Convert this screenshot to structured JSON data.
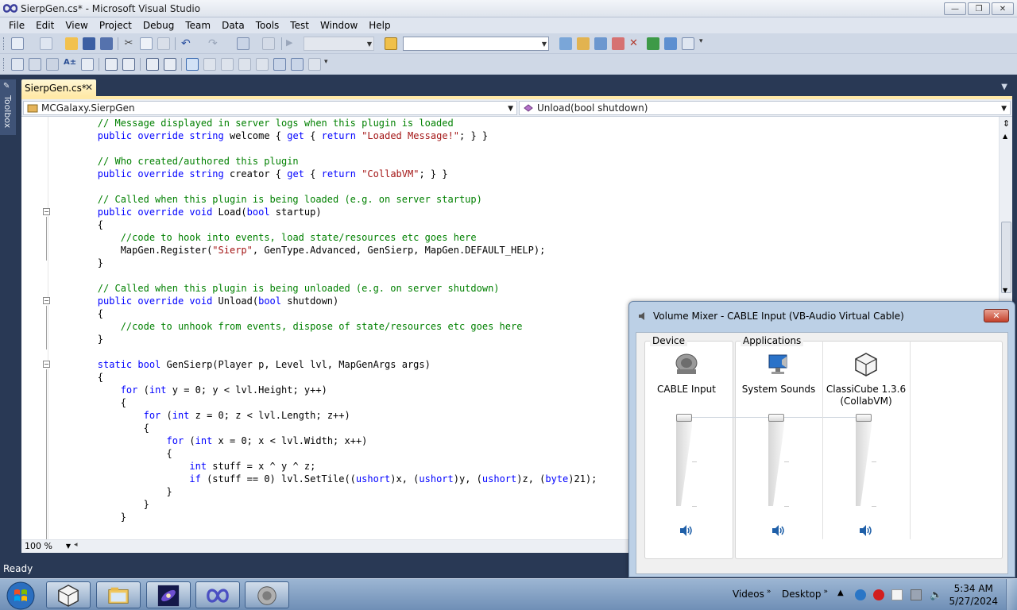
{
  "window": {
    "title": "SierpGen.cs* - Microsoft Visual Studio",
    "min_glyph": "—",
    "max_glyph": "❐",
    "close_glyph": "✕"
  },
  "menu": [
    "File",
    "Edit",
    "View",
    "Project",
    "Debug",
    "Team",
    "Data",
    "Tools",
    "Test",
    "Window",
    "Help"
  ],
  "toolbox": {
    "label": "Toolbox"
  },
  "document_tab": {
    "label": "SierpGen.cs*",
    "close": "✕"
  },
  "navigation": {
    "type_member": "MCGalaxy.SierpGen",
    "method_member": "Unload(bool shutdown)"
  },
  "code": {
    "lines": [
      [
        {
          "t": "        "
        },
        {
          "c": "cm",
          "t": "// Message displayed in server logs when this plugin is loaded"
        }
      ],
      [
        {
          "t": "        "
        },
        {
          "c": "kw",
          "t": "public override string"
        },
        {
          "t": " welcome { "
        },
        {
          "c": "kw",
          "t": "get"
        },
        {
          "t": " { "
        },
        {
          "c": "kw",
          "t": "return"
        },
        {
          "t": " "
        },
        {
          "c": "st",
          "t": "\"Loaded Message!\""
        },
        {
          "t": "; } }"
        }
      ],
      [
        {
          "t": ""
        }
      ],
      [
        {
          "t": "        "
        },
        {
          "c": "cm",
          "t": "// Who created/authored this plugin"
        }
      ],
      [
        {
          "t": "        "
        },
        {
          "c": "kw",
          "t": "public override string"
        },
        {
          "t": " creator { "
        },
        {
          "c": "kw",
          "t": "get"
        },
        {
          "t": " { "
        },
        {
          "c": "kw",
          "t": "return"
        },
        {
          "t": " "
        },
        {
          "c": "st",
          "t": "\"CollabVM\""
        },
        {
          "t": "; } }"
        }
      ],
      [
        {
          "t": ""
        }
      ],
      [
        {
          "t": "        "
        },
        {
          "c": "cm",
          "t": "// Called when this plugin is being loaded (e.g. on server startup)"
        }
      ],
      [
        {
          "t": "        "
        },
        {
          "c": "kw",
          "t": "public override void"
        },
        {
          "t": " Load("
        },
        {
          "c": "kw",
          "t": "bool"
        },
        {
          "t": " startup)"
        }
      ],
      [
        {
          "t": "        {"
        }
      ],
      [
        {
          "t": "            "
        },
        {
          "c": "cm",
          "t": "//code to hook into events, load state/resources etc goes here"
        }
      ],
      [
        {
          "t": "            MapGen.Register("
        },
        {
          "c": "st",
          "t": "\"Sierp\""
        },
        {
          "t": ", GenType.Advanced, GenSierp, MapGen.DEFAULT_HELP);"
        }
      ],
      [
        {
          "t": "        }"
        }
      ],
      [
        {
          "t": ""
        }
      ],
      [
        {
          "t": "        "
        },
        {
          "c": "cm",
          "t": "// Called when this plugin is being unloaded (e.g. on server shutdown)"
        }
      ],
      [
        {
          "t": "        "
        },
        {
          "c": "kw",
          "t": "public override void"
        },
        {
          "t": " Unload("
        },
        {
          "c": "kw",
          "t": "bool"
        },
        {
          "t": " shutdown)"
        }
      ],
      [
        {
          "t": "        {"
        }
      ],
      [
        {
          "t": "            "
        },
        {
          "c": "cm",
          "t": "//code to unhook from events, dispose of state/resources etc goes here"
        }
      ],
      [
        {
          "t": "        }"
        }
      ],
      [
        {
          "t": ""
        }
      ],
      [
        {
          "t": "        "
        },
        {
          "c": "kw",
          "t": "static bool"
        },
        {
          "t": " GenSierp(Player p, Level lvl, MapGenArgs args)"
        }
      ],
      [
        {
          "t": "        {"
        }
      ],
      [
        {
          "t": "            "
        },
        {
          "c": "kw",
          "t": "for"
        },
        {
          "t": " ("
        },
        {
          "c": "kw",
          "t": "int"
        },
        {
          "t": " y = 0; y < lvl.Height; y++)"
        }
      ],
      [
        {
          "t": "            {"
        }
      ],
      [
        {
          "t": "                "
        },
        {
          "c": "kw",
          "t": "for"
        },
        {
          "t": " ("
        },
        {
          "c": "kw",
          "t": "int"
        },
        {
          "t": " z = 0; z < lvl.Length; z++)"
        }
      ],
      [
        {
          "t": "                {"
        }
      ],
      [
        {
          "t": "                    "
        },
        {
          "c": "kw",
          "t": "for"
        },
        {
          "t": " ("
        },
        {
          "c": "kw",
          "t": "int"
        },
        {
          "t": " x = 0; x < lvl.Width; x++)"
        }
      ],
      [
        {
          "t": "                    {"
        }
      ],
      [
        {
          "t": "                        "
        },
        {
          "c": "kw",
          "t": "int"
        },
        {
          "t": " stuff = x ^ y ^ z;"
        }
      ],
      [
        {
          "t": "                        "
        },
        {
          "c": "kw",
          "t": "if"
        },
        {
          "t": " (stuff == 0) lvl.SetTile(("
        },
        {
          "c": "kw",
          "t": "ushort"
        },
        {
          "t": ")x, ("
        },
        {
          "c": "kw",
          "t": "ushort"
        },
        {
          "t": ")y, ("
        },
        {
          "c": "kw",
          "t": "ushort"
        },
        {
          "t": ")z, ("
        },
        {
          "c": "kw",
          "t": "byte"
        },
        {
          "t": ")21);"
        }
      ],
      [
        {
          "t": "                    }"
        }
      ],
      [
        {
          "t": "                }"
        }
      ],
      [
        {
          "t": "            }"
        }
      ]
    ],
    "colors": {
      "keyword": "#0000ff",
      "comment": "#008000",
      "string": "#a31515"
    }
  },
  "zoom": {
    "value": "100 %"
  },
  "status": {
    "text": "Ready"
  },
  "mixer": {
    "title": "Volume Mixer - CABLE Input (VB-Audio Virtual Cable)",
    "close_glyph": "✕",
    "device_label": "Device",
    "applications_label": "Applications",
    "channels": [
      {
        "name": "CABLE Input",
        "icon": "speaker-device-icon",
        "level": 1.0
      },
      {
        "name": "System Sounds",
        "icon": "system-sounds-icon",
        "level": 1.0
      },
      {
        "name": "ClassiCube 1.3.6\n(CollabVM)",
        "icon": "classicube-icon",
        "level": 1.0
      }
    ]
  },
  "taskbar": {
    "toolbars": [
      {
        "label": "Videos",
        "chev": "»"
      },
      {
        "label": "Desktop",
        "chev": "»"
      }
    ],
    "time": "5:34 AM",
    "date": "5/27/2024"
  }
}
